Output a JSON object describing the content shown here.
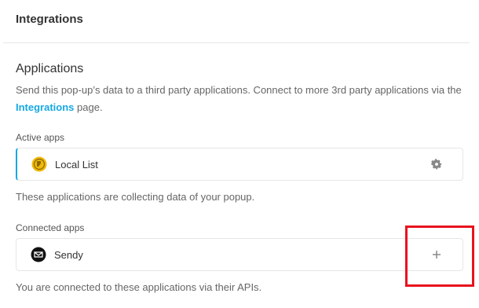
{
  "header": {
    "title": "Integrations"
  },
  "applications": {
    "title": "Applications",
    "description_prefix": "Send this pop-up’s data to a third party applications. Connect to more 3rd party applications via the",
    "description_link": "Integrations",
    "description_suffix": " page."
  },
  "active_apps": {
    "label": "Active apps",
    "items": [
      {
        "name": "Local List",
        "icon": "local-list-icon",
        "action_icon": "gear-icon"
      }
    ],
    "note": "These applications are collecting data of your popup."
  },
  "connected_apps": {
    "label": "Connected apps",
    "items": [
      {
        "name": "Sendy",
        "icon": "sendy-icon",
        "action_icon": "plus-icon"
      }
    ],
    "note": "You are connected to these applications via their APIs."
  },
  "colors": {
    "accent": "#17a8e3",
    "highlight": "#e8121e"
  }
}
